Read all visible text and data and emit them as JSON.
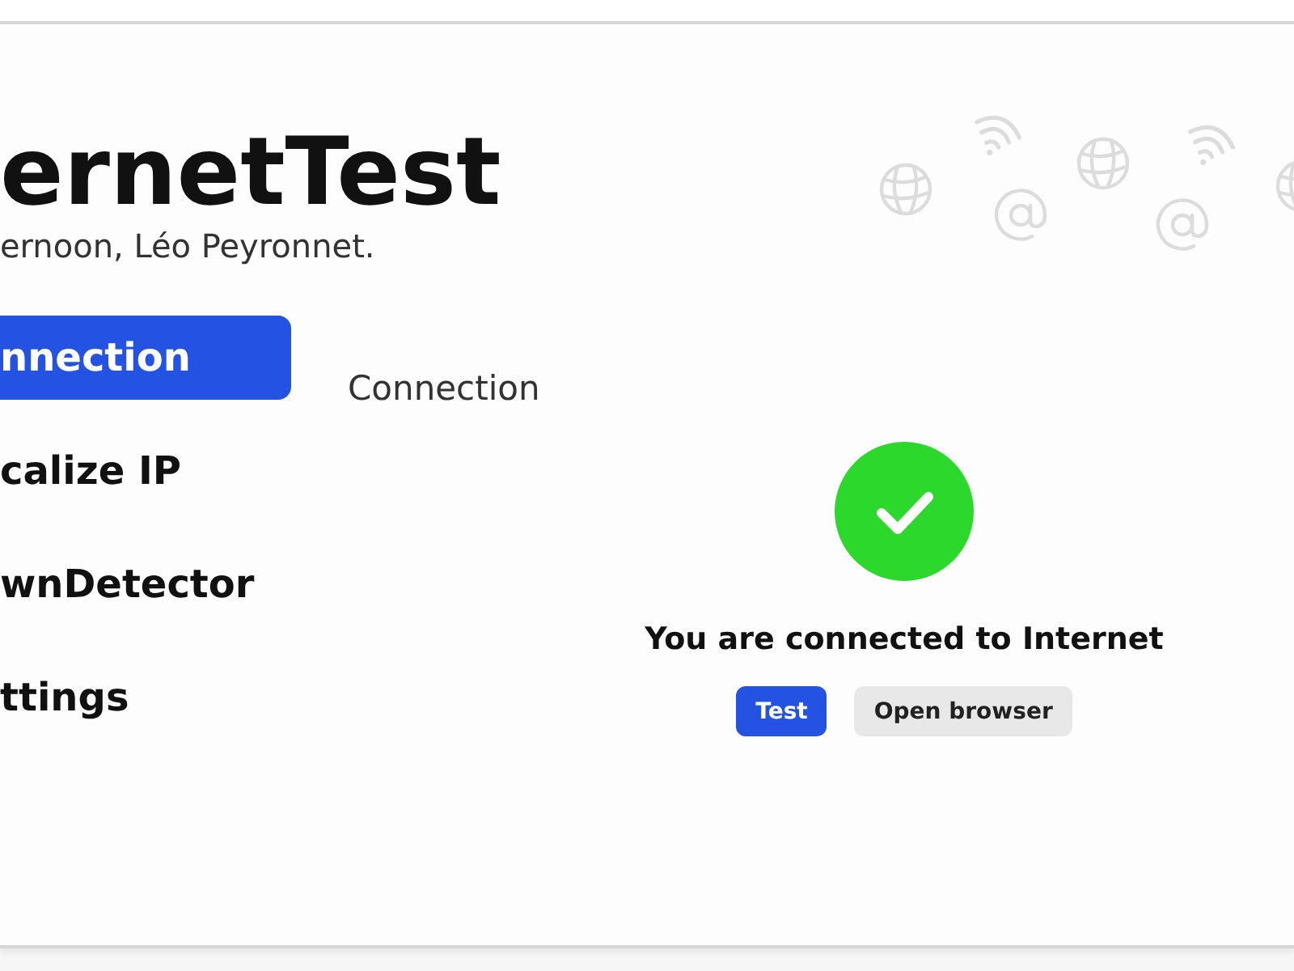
{
  "header": {
    "title": "ernetTest",
    "greeting": "ernoon, Léo Peyronnet."
  },
  "sidebar": {
    "items": [
      {
        "label": "nnection",
        "selected": true
      },
      {
        "label": "calize IP",
        "selected": false
      },
      {
        "label": "wnDetector",
        "selected": false
      },
      {
        "label": "ttings",
        "selected": false
      }
    ]
  },
  "content": {
    "heading": "Connection",
    "status": {
      "kind": "connected",
      "message": "You are connected to Internet"
    },
    "buttons": [
      {
        "label": "Test",
        "kind": "primary"
      },
      {
        "label": "Open browser",
        "kind": "secondary"
      }
    ]
  }
}
